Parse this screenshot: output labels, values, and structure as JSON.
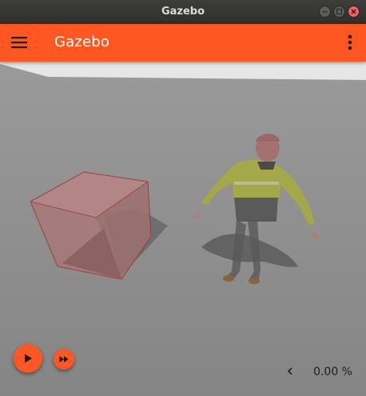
{
  "window": {
    "title": "Gazebo",
    "controls": [
      "minimize-icon",
      "maximize-icon",
      "close-icon"
    ]
  },
  "appbar": {
    "title": "Gazebo",
    "menu_icon": "hamburger-menu-icon",
    "overflow_icon": "more-vert-icon",
    "color": "#ff5722"
  },
  "scene": {
    "background": "#8c8c8c",
    "objects": [
      {
        "name": "box",
        "color": "#b06f6f"
      },
      {
        "name": "actor",
        "description_icon": "person-model"
      }
    ]
  },
  "playback": {
    "play_icon": "play-icon",
    "step_icon": "fast-forward-icon",
    "rtf_chevron_icon": "chevron-left-icon",
    "rtf_value": "0.00 %"
  }
}
